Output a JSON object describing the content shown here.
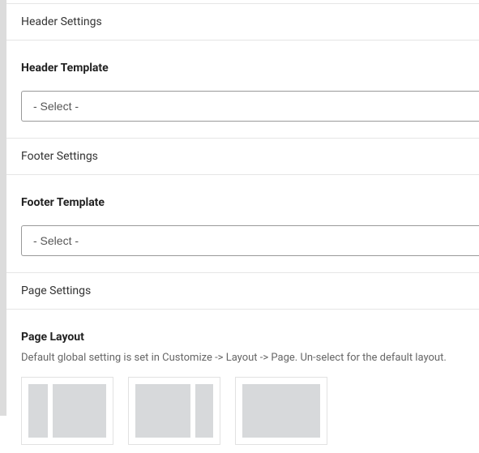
{
  "sections": {
    "header": {
      "title": "Header Settings"
    },
    "footer": {
      "title": "Footer Settings"
    },
    "page": {
      "title": "Page Settings"
    }
  },
  "fields": {
    "header_template": {
      "label": "Header Template",
      "selected": "- Select -"
    },
    "footer_template": {
      "label": "Footer Template",
      "selected": "- Select -"
    },
    "page_layout": {
      "label": "Page Layout",
      "help": "Default global setting is set in Customize -> Layout -> Page. Un-select for the default layout."
    }
  }
}
